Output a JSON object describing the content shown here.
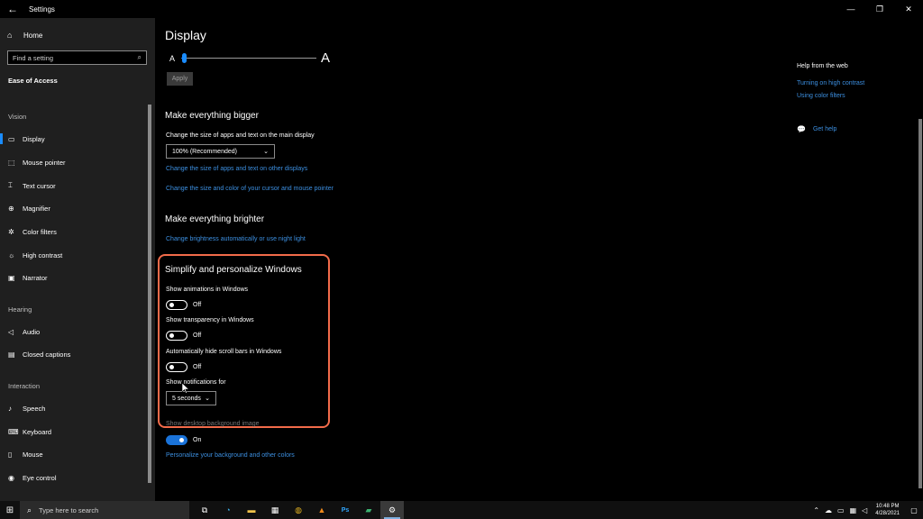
{
  "window": {
    "title": "Settings",
    "back_icon": "←",
    "controls": {
      "minimize": "—",
      "maximize": "❐",
      "close": "✕"
    }
  },
  "sidebar": {
    "home_label": "Home",
    "search_placeholder": "Find a setting",
    "section_title": "Ease of Access",
    "groups": {
      "vision": "Vision",
      "hearing": "Hearing",
      "interaction": "Interaction"
    },
    "items": [
      {
        "label": "Display",
        "active": true
      },
      {
        "label": "Mouse pointer"
      },
      {
        "label": "Text cursor"
      },
      {
        "label": "Magnifier"
      },
      {
        "label": "Color filters"
      },
      {
        "label": "High contrast"
      },
      {
        "label": "Narrator"
      },
      {
        "label": "Audio"
      },
      {
        "label": "Closed captions"
      },
      {
        "label": "Speech"
      },
      {
        "label": "Keyboard"
      },
      {
        "label": "Mouse"
      },
      {
        "label": "Eye control"
      }
    ]
  },
  "main": {
    "page_title": "Display",
    "slider": {
      "small_label": "A",
      "large_label": "A",
      "value_fraction": 0.02
    },
    "apply_label": "Apply",
    "bigger": {
      "heading": "Make everything bigger",
      "size_label": "Change the size of apps and text on the main display",
      "size_value": "100% (Recommended)",
      "link_other_displays": "Change the size of apps and text on other displays",
      "link_cursor": "Change the size and color of your cursor and mouse pointer"
    },
    "brighter": {
      "heading": "Make everything brighter",
      "link_brightness": "Change brightness automatically or use night light"
    },
    "simplify": {
      "heading": "Simplify and personalize Windows",
      "animations_label": "Show animations in Windows",
      "animations_state": "Off",
      "transparency_label": "Show transparency in Windows",
      "transparency_state": "Off",
      "scrollbars_label": "Automatically hide scroll bars in Windows",
      "scrollbars_state": "Off",
      "notifications_label": "Show notifications for",
      "notifications_value": "5 seconds",
      "desktop_bg_label": "Show desktop background image",
      "desktop_bg_state": "On",
      "link_personalize": "Personalize your background and other colors"
    }
  },
  "help": {
    "title": "Help from the web",
    "links": [
      "Turning on high contrast",
      "Using color filters"
    ],
    "get_help": "Get help"
  },
  "taskbar": {
    "search_placeholder": "Type here to search",
    "photoshop_label": "Ps",
    "clock_time": "10:48 PM",
    "clock_date": "4/28/2021"
  },
  "colors": {
    "accent": "#1a8cff",
    "link": "#3c8fe0",
    "highlight_border": "#f26b4a",
    "sidebar_bg": "#1f1f1f"
  }
}
